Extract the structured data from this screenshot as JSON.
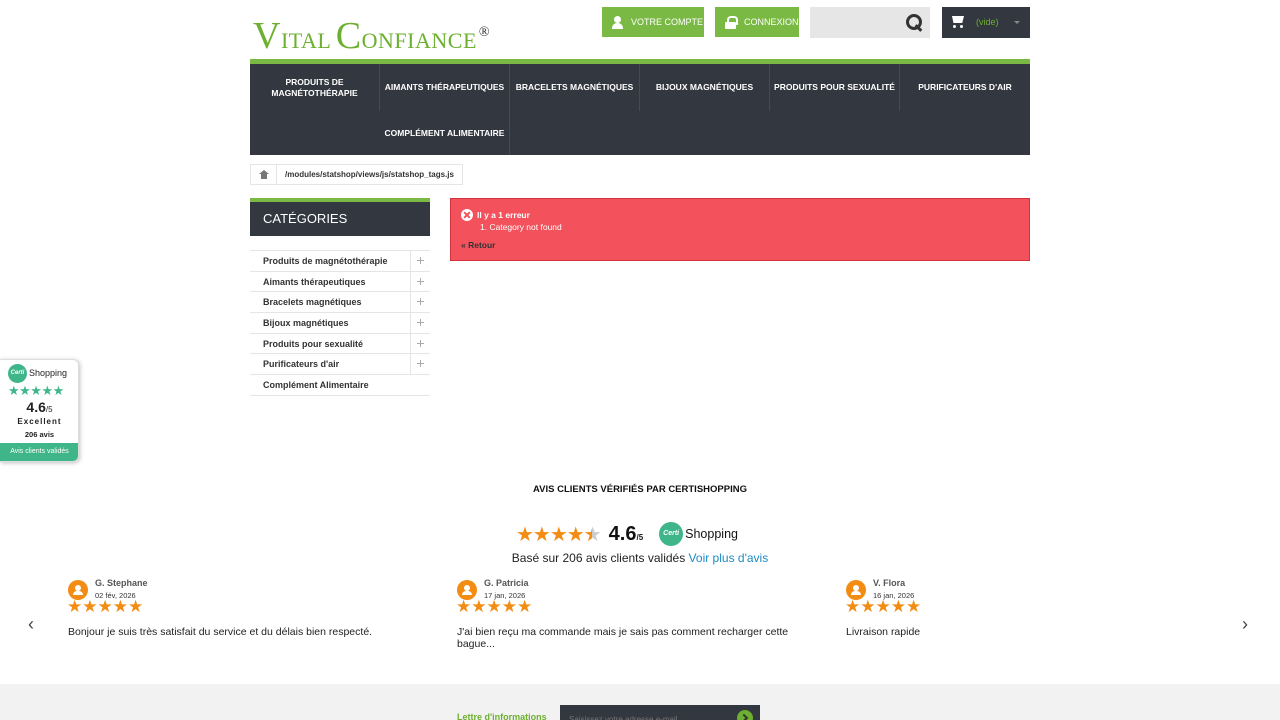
{
  "logo": {
    "v": "V",
    "ital": "ITAL",
    "c": "C",
    "onfiance": "ONFIANCE",
    "reg": "®"
  },
  "header": {
    "account_label": "Votre compte",
    "login_label": "Connexion",
    "search_placeholder": "",
    "cart_label": "(vide)"
  },
  "menu": {
    "items": [
      "Produits de magnétothérapie",
      "Aimants thérapeutiques",
      "Bracelets magnétiques",
      "Bijoux magnétiques",
      "Produits pour sexualité",
      "Purificateurs d'air",
      "Complément alimentaire"
    ]
  },
  "breadcrumb": {
    "path": "/modules/statshop/views/js/statshop_tags.js"
  },
  "sidebar": {
    "title": "Catégories",
    "items": [
      "Produits de magnétothérapie",
      "Aimants thérapeutiques",
      "Bracelets magnétiques",
      "Bijoux magnétiques",
      "Produits pour sexualité",
      "Purificateurs d'air",
      "Complément Alimentaire"
    ]
  },
  "error": {
    "title": "Il y a 1 erreur",
    "message": "1. Category not found",
    "back": "« Retour"
  },
  "widget": {
    "logo_text": "Certi",
    "brand": "Shopping",
    "stars": "★★★★★",
    "score": "4.6",
    "score_max": "/5",
    "grade": "Excellent",
    "count": "206 avis",
    "footer": "Avis clients validés"
  },
  "reviews": {
    "title": "AVIS CLIENTS VÉRIFIÉS PAR CERTISHOPPING",
    "stars_full": "★★★★",
    "star_half": "★",
    "rating": 4.6,
    "score": "4.6",
    "score_max": "/5",
    "logo_text": "Certi",
    "brand": "Shopping",
    "based_on": "Basé sur 206 avis clients validés",
    "see_more": "Voir plus d'avis",
    "prev": "‹",
    "next": "›",
    "items": [
      {
        "name": "G. Stephane",
        "date": "02 fév, 2026",
        "stars": "★★★★★",
        "text": "Bonjour je suis très satisfait du service et du délais bien respecté."
      },
      {
        "name": "G. Patricia",
        "date": "17 jan, 2026",
        "stars": "★★★★★",
        "text": "J'ai bien reçu ma commande mais je sais pas comment recharger cette bague..."
      },
      {
        "name": "V. Flora",
        "date": "16 jan, 2026",
        "stars": "★★★★★",
        "text": "Livraison rapide"
      }
    ]
  },
  "newsletter": {
    "label": "Lettre d'informations",
    "placeholder": "Saisissez votre adresse e-mail"
  },
  "colors": {
    "brand_green": "#7ab943",
    "dark": "#333740",
    "error": "#f3515c",
    "star_orange": "#f28c12",
    "certi_green": "#3fb58a"
  }
}
